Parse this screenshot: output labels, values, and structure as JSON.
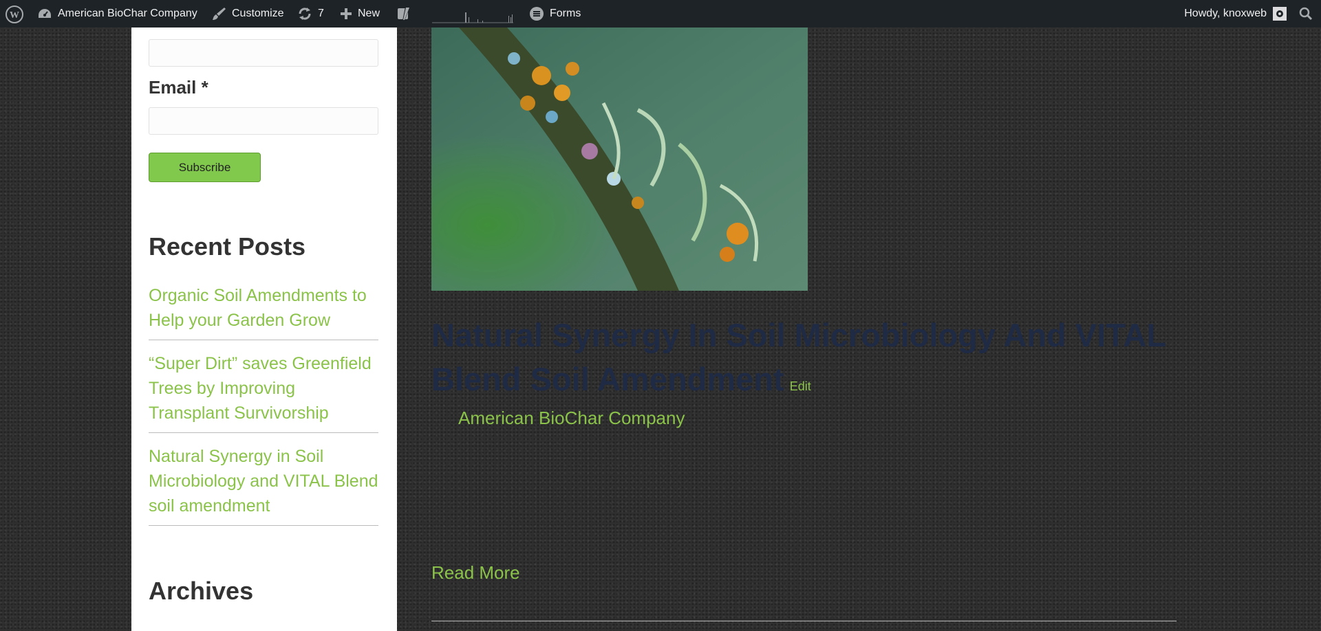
{
  "admin_bar": {
    "site_name": "American BioChar Company",
    "customize": "Customize",
    "updates_count": "7",
    "new": "New",
    "forms": "Forms",
    "howdy": "Howdy, knoxweb",
    "icons": [
      "wordpress-icon",
      "dashboard-icon",
      "brush-icon",
      "refresh-icon",
      "plus-icon",
      "yoast-icon",
      "stats-icon",
      "forms-icon",
      "avatar-icon",
      "search-icon"
    ]
  },
  "sidebar": {
    "email_label": "Email *",
    "subscribe_label": "Subscribe",
    "recent_posts_heading": "Recent Posts",
    "recent_posts": [
      "Organic Soil Amendments to Help your Garden Grow",
      "“Super Dirt” saves Greenfield Trees by Improving Transplant Survivorship",
      "Natural Synergy in Soil Microbiology and VITAL Blend soil amendment"
    ],
    "archives_heading": "Archives"
  },
  "post": {
    "title": "Natural Synergy In Soil Microbiology And VITAL Blend Soil Amendment",
    "edit_label": "Edit",
    "author": "American BioChar Company",
    "read_more": "Read More"
  },
  "colors": {
    "admin_bar_bg": "#1d2327",
    "accent_green": "#8bc34a",
    "button_green": "#81c94c",
    "title_navy": "#1f2a44",
    "page_bg": "#2f2f2f"
  }
}
